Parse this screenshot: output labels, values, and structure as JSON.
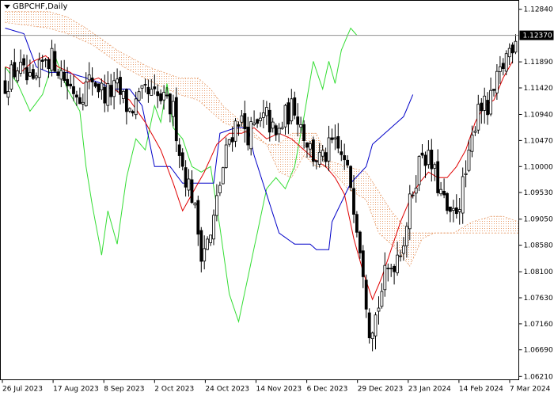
{
  "chart_data": {
    "type": "candlestick",
    "symbol": "GBPCHF",
    "timeframe": "Daily",
    "title": "GBPCHF,Daily",
    "current_price_label": "1.12370",
    "current_price": 1.1237,
    "ylim": [
      1.0615,
      1.13
    ],
    "y_ticks": [
      "1.12840",
      "1.12370",
      "1.11890",
      "1.11420",
      "1.10940",
      "1.10470",
      "1.10000",
      "1.09530",
      "1.09050",
      "1.08580",
      "1.08100",
      "1.07630",
      "1.07160",
      "1.06690",
      "1.06210"
    ],
    "x_ticks": [
      "26 Jul 2023",
      "17 Aug 2023",
      "8 Sep 2023",
      "2 Oct 2023",
      "24 Oct 2023",
      "14 Nov 2023",
      "6 Dec 2023",
      "29 Dec 2023",
      "23 Jan 2024",
      "14 Feb 2024",
      "7 Mar 2024"
    ],
    "n_bars": 165,
    "indicators": [
      "Tenkan-sen",
      "Kijun-sen",
      "Chikou Span",
      "Senkou Span A",
      "Senkou Span B"
    ],
    "colors": {
      "candle": "#000000",
      "tenkan": "#e00000",
      "kijun": "#0000c8",
      "chikou": "#33dd33",
      "cloud": "#e8a070",
      "price_line": "#909090",
      "price_label_bg": "#000000"
    },
    "keypoints_close": [
      [
        0,
        1.115
      ],
      [
        4,
        1.118
      ],
      [
        9,
        1.114
      ],
      [
        13,
        1.12
      ],
      [
        16,
        1.119
      ],
      [
        20,
        1.115
      ],
      [
        24,
        1.113
      ],
      [
        28,
        1.116
      ],
      [
        32,
        1.113
      ],
      [
        36,
        1.114
      ],
      [
        40,
        1.11
      ],
      [
        45,
        1.113
      ],
      [
        50,
        1.112
      ],
      [
        54,
        1.11
      ],
      [
        57,
        1.1
      ],
      [
        60,
        1.095
      ],
      [
        63,
        1.085
      ],
      [
        66,
        1.087
      ],
      [
        69,
        1.097
      ],
      [
        72,
        1.105
      ],
      [
        75,
        1.109
      ],
      [
        78,
        1.106
      ],
      [
        81,
        1.107
      ],
      [
        84,
        1.109
      ],
      [
        87,
        1.105
      ],
      [
        90,
        1.109
      ],
      [
        93,
        1.111
      ],
      [
        96,
        1.106
      ],
      [
        99,
        1.102
      ],
      [
        102,
        1.101
      ],
      [
        105,
        1.104
      ],
      [
        108,
        1.102
      ],
      [
        111,
        1.097
      ],
      [
        113,
        1.09
      ],
      [
        115,
        1.082
      ],
      [
        117,
        1.071
      ],
      [
        119,
        1.073
      ],
      [
        122,
        1.08
      ],
      [
        125,
        1.083
      ],
      [
        128,
        1.087
      ],
      [
        131,
        1.096
      ],
      [
        134,
        1.103
      ],
      [
        137,
        1.1
      ],
      [
        140,
        1.095
      ],
      [
        143,
        1.09
      ],
      [
        146,
        1.094
      ],
      [
        149,
        1.101
      ],
      [
        152,
        1.112
      ],
      [
        155,
        1.11
      ],
      [
        158,
        1.115
      ],
      [
        161,
        1.12
      ],
      [
        164,
        1.1237
      ]
    ],
    "keypoints_kijun": [
      [
        0,
        1.125
      ],
      [
        6,
        1.124
      ],
      [
        10,
        1.118
      ],
      [
        14,
        1.117
      ],
      [
        20,
        1.117
      ],
      [
        26,
        1.116
      ],
      [
        31,
        1.115
      ],
      [
        34,
        1.114
      ],
      [
        40,
        1.114
      ],
      [
        44,
        1.111
      ],
      [
        48,
        1.1
      ],
      [
        53,
        1.1
      ],
      [
        57,
        1.097
      ],
      [
        67,
        1.097
      ],
      [
        69,
        1.106
      ],
      [
        74,
        1.107
      ],
      [
        78,
        1.107
      ],
      [
        80,
        1.102
      ],
      [
        84,
        1.095
      ],
      [
        88,
        1.088
      ],
      [
        93,
        1.086
      ],
      [
        98,
        1.086
      ],
      [
        100,
        1.085
      ],
      [
        104,
        1.085
      ],
      [
        105,
        1.09
      ],
      [
        111,
        1.097
      ],
      [
        116,
        1.1
      ],
      [
        118,
        1.104
      ],
      [
        128,
        1.109
      ],
      [
        131,
        1.113
      ]
    ],
    "keypoints_tenkan": [
      [
        0,
        1.118
      ],
      [
        5,
        1.117
      ],
      [
        9,
        1.119
      ],
      [
        13,
        1.12
      ],
      [
        17,
        1.118
      ],
      [
        21,
        1.117
      ],
      [
        25,
        1.115
      ],
      [
        30,
        1.116
      ],
      [
        35,
        1.114
      ],
      [
        40,
        1.112
      ],
      [
        45,
        1.108
      ],
      [
        50,
        1.103
      ],
      [
        54,
        1.097
      ],
      [
        57,
        1.092
      ],
      [
        60,
        1.095
      ],
      [
        64,
        1.099
      ],
      [
        68,
        1.104
      ],
      [
        72,
        1.106
      ],
      [
        76,
        1.106
      ],
      [
        80,
        1.107
      ],
      [
        84,
        1.105
      ],
      [
        88,
        1.106
      ],
      [
        92,
        1.105
      ],
      [
        96,
        1.103
      ],
      [
        100,
        1.101
      ],
      [
        103,
        1.1
      ],
      [
        106,
        1.098
      ],
      [
        109,
        1.095
      ],
      [
        112,
        1.087
      ],
      [
        115,
        1.081
      ],
      [
        118,
        1.076
      ],
      [
        121,
        1.08
      ],
      [
        124,
        1.085
      ],
      [
        127,
        1.09
      ],
      [
        130,
        1.094
      ],
      [
        133,
        1.097
      ],
      [
        136,
        1.099
      ],
      [
        139,
        1.098
      ],
      [
        142,
        1.098
      ],
      [
        145,
        1.1
      ],
      [
        148,
        1.103
      ],
      [
        151,
        1.108
      ],
      [
        154,
        1.111
      ],
      [
        157,
        1.112
      ],
      [
        160,
        1.116
      ],
      [
        163,
        1.119
      ]
    ],
    "keypoints_chikou": [
      [
        0,
        1.118
      ],
      [
        4,
        1.115
      ],
      [
        8,
        1.11
      ],
      [
        12,
        1.113
      ],
      [
        16,
        1.12
      ],
      [
        20,
        1.114
      ],
      [
        24,
        1.11
      ],
      [
        26,
        1.1
      ],
      [
        28,
        1.093
      ],
      [
        31,
        1.084
      ],
      [
        33,
        1.092
      ],
      [
        36,
        1.086
      ],
      [
        39,
        1.098
      ],
      [
        42,
        1.105
      ],
      [
        45,
        1.103
      ],
      [
        48,
        1.111
      ],
      [
        50,
        1.108
      ],
      [
        52,
        1.115
      ],
      [
        54,
        1.107
      ],
      [
        57,
        1.105
      ],
      [
        60,
        1.1
      ],
      [
        63,
        1.099
      ],
      [
        66,
        1.1
      ],
      [
        69,
        1.089
      ],
      [
        72,
        1.077
      ],
      [
        75,
        1.072
      ],
      [
        78,
        1.08
      ],
      [
        81,
        1.088
      ],
      [
        84,
        1.096
      ],
      [
        87,
        1.098
      ],
      [
        90,
        1.096
      ],
      [
        93,
        1.1
      ],
      [
        96,
        1.109
      ],
      [
        99,
        1.119
      ],
      [
        102,
        1.114
      ],
      [
        104,
        1.119
      ],
      [
        106,
        1.115
      ],
      [
        108,
        1.121
      ],
      [
        111,
        1.125
      ],
      [
        113,
        1.1237
      ]
    ],
    "keypoints_span_a": [
      [
        0,
        1.126
      ],
      [
        14,
        1.125
      ],
      [
        20,
        1.124
      ],
      [
        28,
        1.122
      ],
      [
        38,
        1.118
      ],
      [
        48,
        1.115
      ],
      [
        56,
        1.113
      ],
      [
        62,
        1.112
      ],
      [
        70,
        1.108
      ],
      [
        78,
        1.106
      ],
      [
        84,
        1.104
      ],
      [
        88,
        1.099
      ],
      [
        92,
        1.098
      ],
      [
        96,
        1.102
      ],
      [
        100,
        1.1
      ],
      [
        104,
        1.1
      ],
      [
        110,
        1.096
      ],
      [
        116,
        1.094
      ],
      [
        120,
        1.088
      ],
      [
        126,
        1.085
      ],
      [
        130,
        1.082
      ],
      [
        134,
        1.087
      ],
      [
        138,
        1.088
      ],
      [
        144,
        1.088
      ],
      [
        150,
        1.09
      ],
      [
        156,
        1.091
      ],
      [
        160,
        1.091
      ],
      [
        165,
        1.09
      ]
    ],
    "keypoints_span_b": [
      [
        0,
        1.128
      ],
      [
        14,
        1.128
      ],
      [
        20,
        1.127
      ],
      [
        26,
        1.125
      ],
      [
        36,
        1.121
      ],
      [
        46,
        1.118
      ],
      [
        56,
        1.116
      ],
      [
        62,
        1.116
      ],
      [
        66,
        1.114
      ],
      [
        70,
        1.111
      ],
      [
        78,
        1.107
      ],
      [
        84,
        1.104
      ],
      [
        88,
        1.104
      ],
      [
        92,
        1.106
      ],
      [
        100,
        1.106
      ],
      [
        104,
        1.101
      ],
      [
        110,
        1.1
      ],
      [
        116,
        1.099
      ],
      [
        124,
        1.092
      ],
      [
        130,
        1.088
      ],
      [
        136,
        1.088
      ],
      [
        144,
        1.088
      ],
      [
        150,
        1.088
      ],
      [
        156,
        1.088
      ],
      [
        165,
        1.088
      ]
    ]
  }
}
